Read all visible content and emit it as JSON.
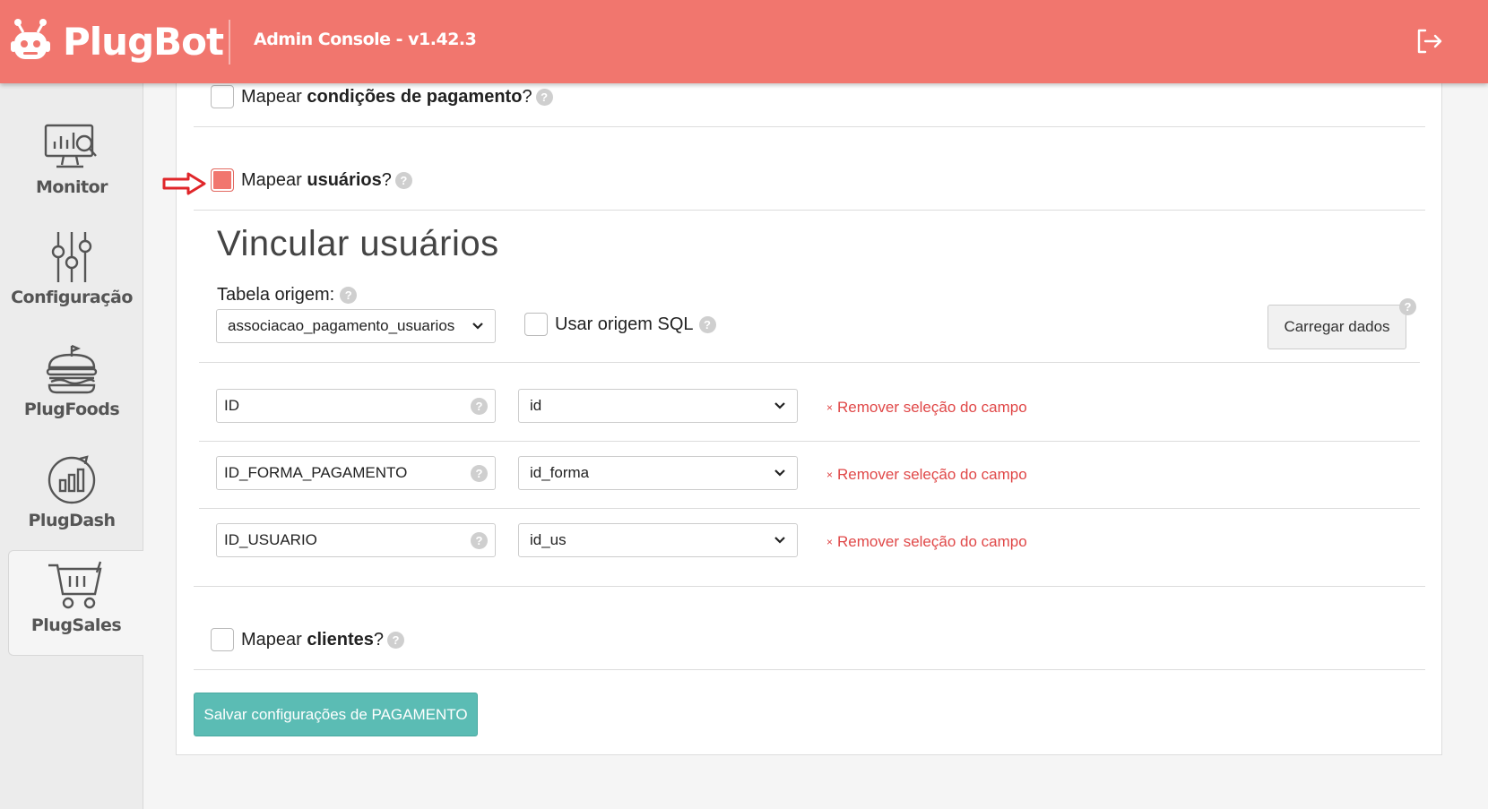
{
  "header": {
    "brand": "PlugBot",
    "title": "Admin Console - v1.42.3",
    "logout_icon": "logout-icon"
  },
  "sidebar": {
    "items": [
      {
        "label": "Monitor",
        "icon": "monitor-icon"
      },
      {
        "label": "Configuração",
        "icon": "sliders-icon"
      },
      {
        "label": "PlugFoods",
        "icon": "burger-icon"
      },
      {
        "label": "PlugDash",
        "icon": "dashboard-icon"
      },
      {
        "label": "PlugSales",
        "icon": "cart-icon",
        "active": true
      }
    ]
  },
  "options": {
    "payment_conditions": {
      "prefix": "Mapear ",
      "bold": "condições de pagamento",
      "suffix": "?",
      "checked": false
    },
    "users": {
      "prefix": "Mapear ",
      "bold": "usuários",
      "suffix": "?",
      "checked": true
    },
    "clients": {
      "prefix": "Mapear ",
      "bold": "clientes",
      "suffix": "?",
      "checked": false
    }
  },
  "users_section": {
    "title": "Vincular usuários",
    "source_table_label": "Tabela origem:",
    "source_table_value": "associacao_pagamento_usuarios",
    "use_sql_label": "Usar origem SQL",
    "use_sql_checked": false,
    "load_button": "Carregar dados",
    "fields": [
      {
        "name": "ID",
        "column": "id",
        "remove": "Remover seleção do campo"
      },
      {
        "name": "ID_FORMA_PAGAMENTO",
        "column": "id_forma",
        "remove": "Remover seleção do campo"
      },
      {
        "name": "ID_USUARIO",
        "column": "id_us",
        "remove": "Remover seleção do campo"
      }
    ]
  },
  "save_button": "Salvar configurações de PAGAMENTO",
  "help_glyph": "?",
  "remove_glyph": "×",
  "colors": {
    "header": "#f1766e",
    "save": "#5bbcb4",
    "remove": "#e04848"
  }
}
